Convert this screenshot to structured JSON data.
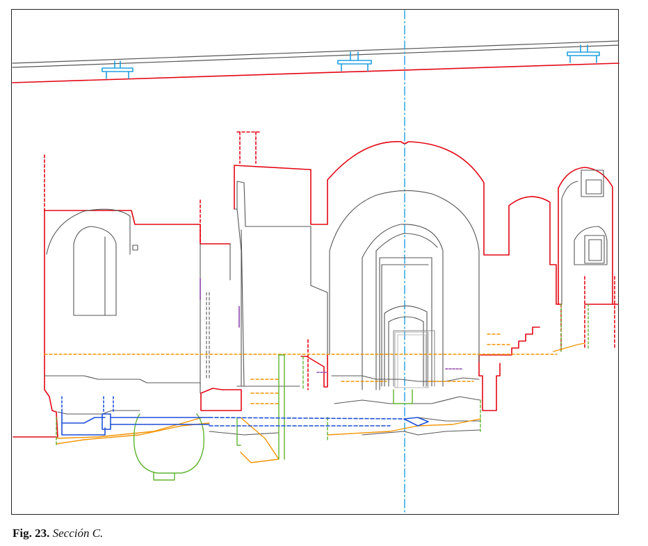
{
  "figure": {
    "caption_label": "Fig. 23.",
    "caption_text": "Sección C."
  },
  "colors": {
    "existing_structure": "#e30613",
    "outline": "#555555",
    "roof_beams": "#1ea0e0",
    "axis": "#1ea0e0",
    "level_line": "#f39200",
    "foundations": "#5fb32e",
    "pipes": "#1d4fd8",
    "accent": "#8e44ad"
  },
  "legend_icons": [
    "section-axis-icon",
    "beam-support-icon"
  ]
}
